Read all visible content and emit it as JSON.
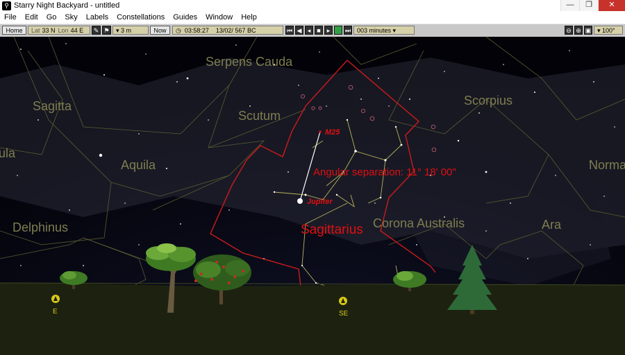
{
  "window": {
    "title": "Starry Night Backyard - untitled",
    "icon": "telescope-icon"
  },
  "menu": [
    "File",
    "Edit",
    "Go",
    "Sky",
    "Labels",
    "Constellations",
    "Guides",
    "Window",
    "Help"
  ],
  "toolbar": {
    "home": "Home",
    "lat_label": "Lat",
    "lat": "33 N",
    "lon_label": "Lon",
    "lon": "44 E",
    "elevation": "▾ 3 m",
    "now": "Now",
    "time": "03:58:27",
    "date": "13/02/  567 BC",
    "time_step": "003 minutes ▾",
    "fov": "▾ 100°"
  },
  "sky": {
    "constellations": [
      "Serpens Cauda",
      "Sagitta",
      "Scutum",
      "Scorpius",
      "Aquila",
      "Norma",
      "ula",
      "Delphinus",
      "Sagittarius",
      "Corona Australis",
      "Ara"
    ],
    "objects": {
      "m25": "M25",
      "jupiter": "Jupiter"
    },
    "measurement": "Angular separation: 11° 18' 00\"",
    "compass": {
      "east": "E",
      "southeast": "SE"
    }
  },
  "colors": {
    "highlight": "#e01010",
    "constellation_label": "#8a8a55",
    "ground": "#1d2210"
  }
}
